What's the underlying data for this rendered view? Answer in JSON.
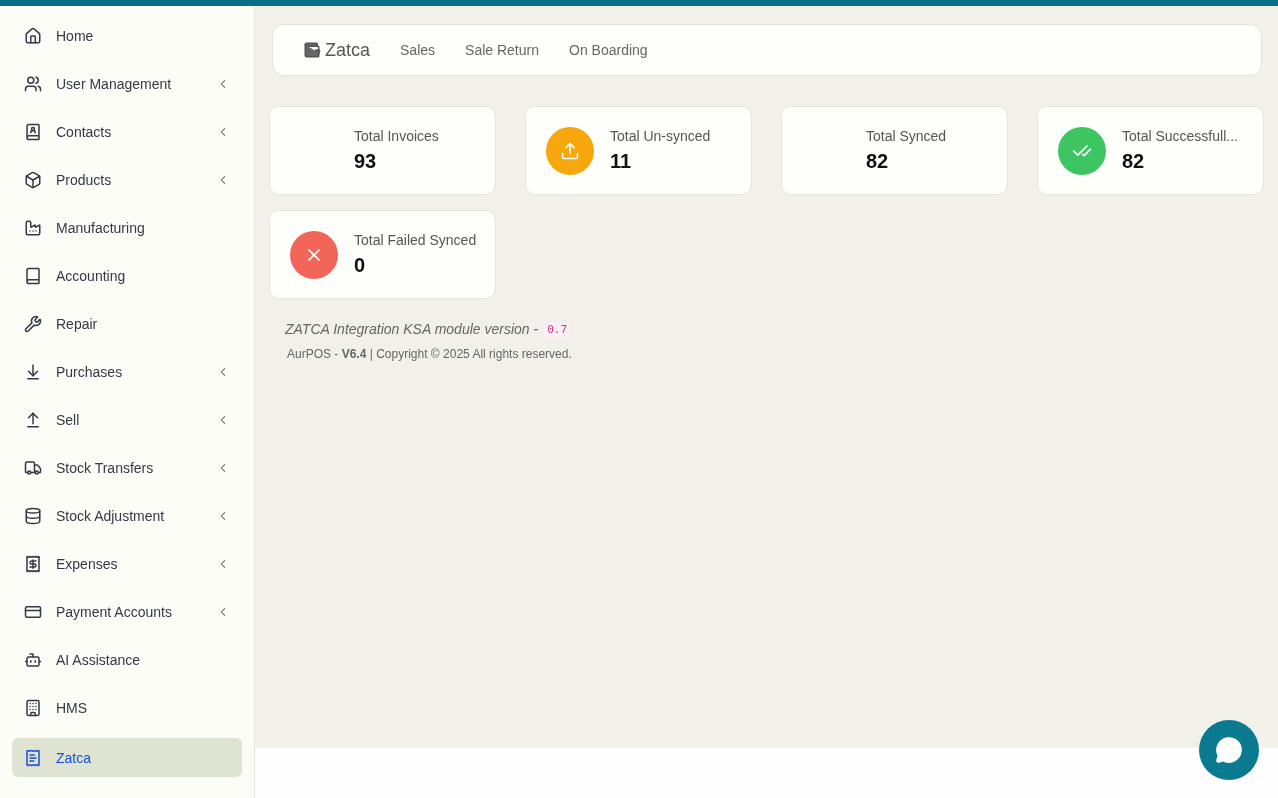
{
  "sidebar": {
    "items": [
      {
        "label": "Home",
        "submenu": false,
        "selected": false
      },
      {
        "label": "User Management",
        "submenu": true,
        "selected": false
      },
      {
        "label": "Contacts",
        "submenu": true,
        "selected": false
      },
      {
        "label": "Products",
        "submenu": true,
        "selected": false
      },
      {
        "label": "Manufacturing",
        "submenu": false,
        "selected": false
      },
      {
        "label": "Accounting",
        "submenu": false,
        "selected": false
      },
      {
        "label": "Repair",
        "submenu": false,
        "selected": false
      },
      {
        "label": "Purchases",
        "submenu": true,
        "selected": false
      },
      {
        "label": "Sell",
        "submenu": true,
        "selected": false
      },
      {
        "label": "Stock Transfers",
        "submenu": true,
        "selected": false
      },
      {
        "label": "Stock Adjustment",
        "submenu": true,
        "selected": false
      },
      {
        "label": "Expenses",
        "submenu": true,
        "selected": false
      },
      {
        "label": "Payment Accounts",
        "submenu": true,
        "selected": false
      },
      {
        "label": "AI Assistance",
        "submenu": false,
        "selected": false
      },
      {
        "label": "HMS",
        "submenu": false,
        "selected": false
      },
      {
        "label": "Zatca",
        "submenu": false,
        "selected": true
      }
    ]
  },
  "nav": {
    "title": "Zatca",
    "links": [
      "Sales",
      "Sale Return",
      "On Boarding"
    ]
  },
  "cards": [
    {
      "kind": "plain",
      "label": "Total Invoices",
      "value": "93"
    },
    {
      "kind": "upload",
      "label": "Total Un-synced",
      "value": "11",
      "color": "#f5a70c"
    },
    {
      "kind": "plain",
      "label": "Total Synced",
      "value": "82"
    },
    {
      "kind": "check",
      "label": "Total Successfull...",
      "value": "82",
      "color": "#3cc560"
    },
    {
      "kind": "failed",
      "label": "Total Failed Synced",
      "value": "0",
      "color": "#f2665a"
    }
  ],
  "version": {
    "text": "ZATCA Integration KSA module version -",
    "code": "0.7"
  },
  "footer": "AurPOS - **V6.4** | Copyright © 2025 All rights reserved."
}
